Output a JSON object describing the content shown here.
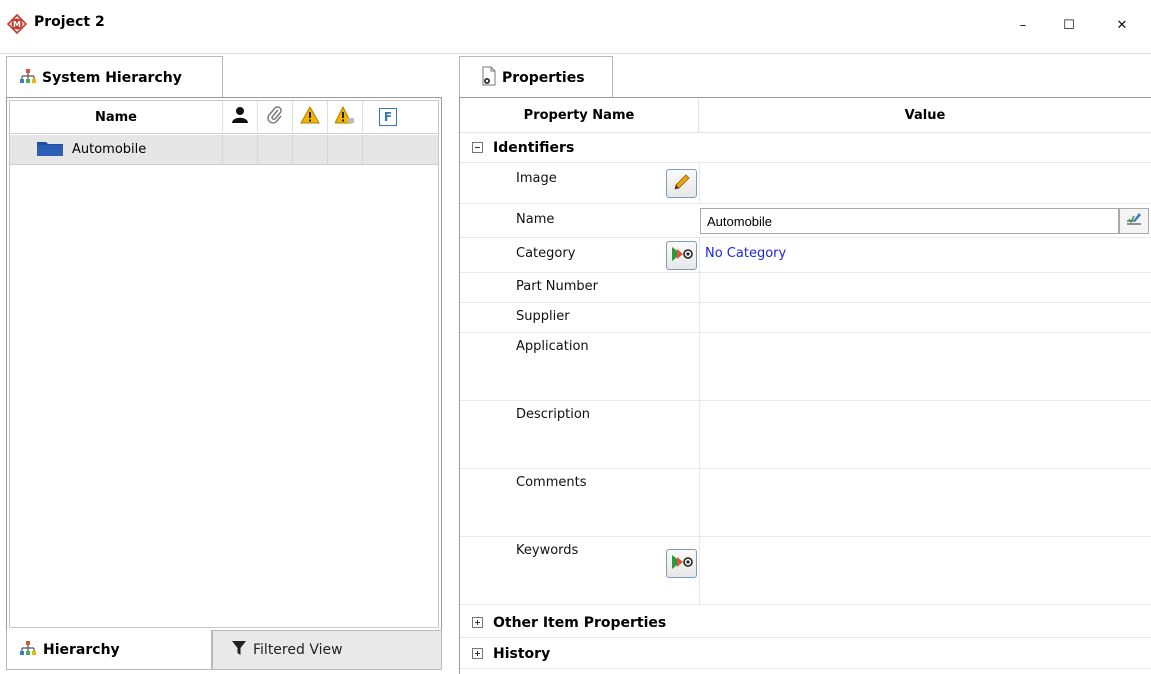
{
  "window": {
    "title": "Project 2",
    "controls": {
      "minimize": "–",
      "maximize": "☐",
      "close": "✕"
    }
  },
  "left": {
    "tab_label": "System Hierarchy",
    "grid": {
      "name_header": "Name",
      "icon_headers": [
        "person-icon",
        "paperclip-icon",
        "warning-icon",
        "warning-small-icon"
      ],
      "filter_header": "F",
      "rows": [
        {
          "name": "Automobile"
        }
      ]
    },
    "bottom_tabs": [
      {
        "label": "Hierarchy",
        "active": true
      },
      {
        "label": "Filtered View",
        "active": false
      }
    ]
  },
  "right": {
    "tab_label": "Properties",
    "headers": {
      "name": "Property Name",
      "value": "Value"
    },
    "sections": {
      "identifiers": "Identifiers",
      "other": "Other Item Properties",
      "history": "History"
    },
    "props": {
      "image": {
        "label": "Image"
      },
      "name": {
        "label": "Name",
        "value": "Automobile"
      },
      "category": {
        "label": "Category",
        "value": "No Category"
      },
      "part_number": {
        "label": "Part Number"
      },
      "supplier": {
        "label": "Supplier"
      },
      "application": {
        "label": "Application"
      },
      "description": {
        "label": "Description"
      },
      "comments": {
        "label": "Comments"
      },
      "keywords": {
        "label": "Keywords"
      }
    }
  },
  "colors": {
    "link": "#1a27e6",
    "folder": "#1f4e9a",
    "warning": "#f2b400",
    "accent": "#3573c3"
  }
}
